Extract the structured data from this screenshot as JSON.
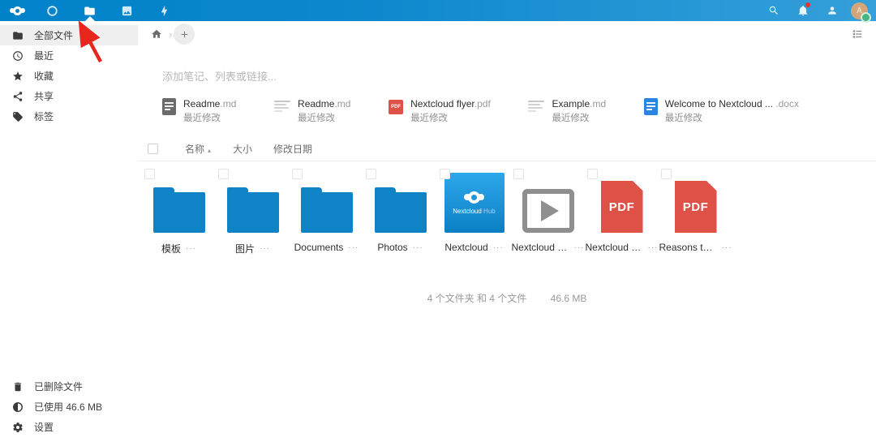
{
  "topbar": {
    "app_icons": [
      "nextcloud-logo",
      "dashboard",
      "files",
      "photos",
      "activity"
    ],
    "active_app": "files",
    "right_icons": [
      "search",
      "notifications",
      "contacts",
      "avatar"
    ],
    "has_notification_badge": true
  },
  "colors": {
    "header_left": "#0082c9",
    "header_right": "#35a0da",
    "folder_blue": "#0f83c6",
    "pdf_red": "#dd5147",
    "docx_blue": "#2a84e0",
    "arrow_red": "#e8261d",
    "status_green": "#49b382"
  },
  "sidebar": {
    "items": [
      {
        "label": "全部文件",
        "icon": "folder",
        "active": true
      },
      {
        "label": "最近",
        "icon": "clock",
        "active": false
      },
      {
        "label": "收藏",
        "icon": "star",
        "active": false
      },
      {
        "label": "共享",
        "icon": "share",
        "active": false
      },
      {
        "label": "标签",
        "icon": "tag",
        "active": false
      }
    ],
    "footer": [
      {
        "label": "已删除文件",
        "icon": "trash"
      },
      {
        "label": "已使用 46.6 MB",
        "icon": "quota"
      },
      {
        "label": "设置",
        "icon": "gear"
      }
    ]
  },
  "breadcrumb": {
    "chevron": "›"
  },
  "notes_placeholder": "添加笔记、列表或链接...",
  "recommended": [
    {
      "name": "Readme",
      "ext": ".md",
      "sub": "最近修改",
      "icon": "md-document-dark"
    },
    {
      "name": "Readme",
      "ext": ".md",
      "sub": "最近修改",
      "icon": "text-preview"
    },
    {
      "name": "Nextcloud flyer",
      "ext": ".pdf",
      "sub": "最近修改",
      "icon": "pdf-badge"
    },
    {
      "name": "Example",
      "ext": ".md",
      "sub": "最近修改",
      "icon": "text-preview"
    },
    {
      "name": "Welcome to Nextcloud ... ",
      "ext": ".docx",
      "sub": "最近修改",
      "icon": "docx-document"
    }
  ],
  "pdf_badge_label": "PDF",
  "table_header": {
    "name": "名称",
    "sort_caret": "▴",
    "size": "大小",
    "modified": "修改日期"
  },
  "menu_dots": "···",
  "grid": [
    {
      "label": "模板",
      "type": "folder"
    },
    {
      "label": "图片",
      "type": "folder"
    },
    {
      "label": "Documents",
      "type": "folder"
    },
    {
      "label": "Photos",
      "type": "folder"
    },
    {
      "label": "Nextcloud",
      "type": "image-thumb"
    },
    {
      "label": "Nextcloud int...",
      "type": "video"
    },
    {
      "label": "Nextcloud M...",
      "type": "pdf"
    },
    {
      "label": "Reasons to us...",
      "type": "pdf"
    }
  ],
  "thumb": {
    "brand": "Nextcloud ",
    "suffix": "Hub"
  },
  "pdf_tile_label": "PDF",
  "summary": {
    "counts": "4 个文件夹 和 4 个文件",
    "size": "46.6 MB"
  }
}
